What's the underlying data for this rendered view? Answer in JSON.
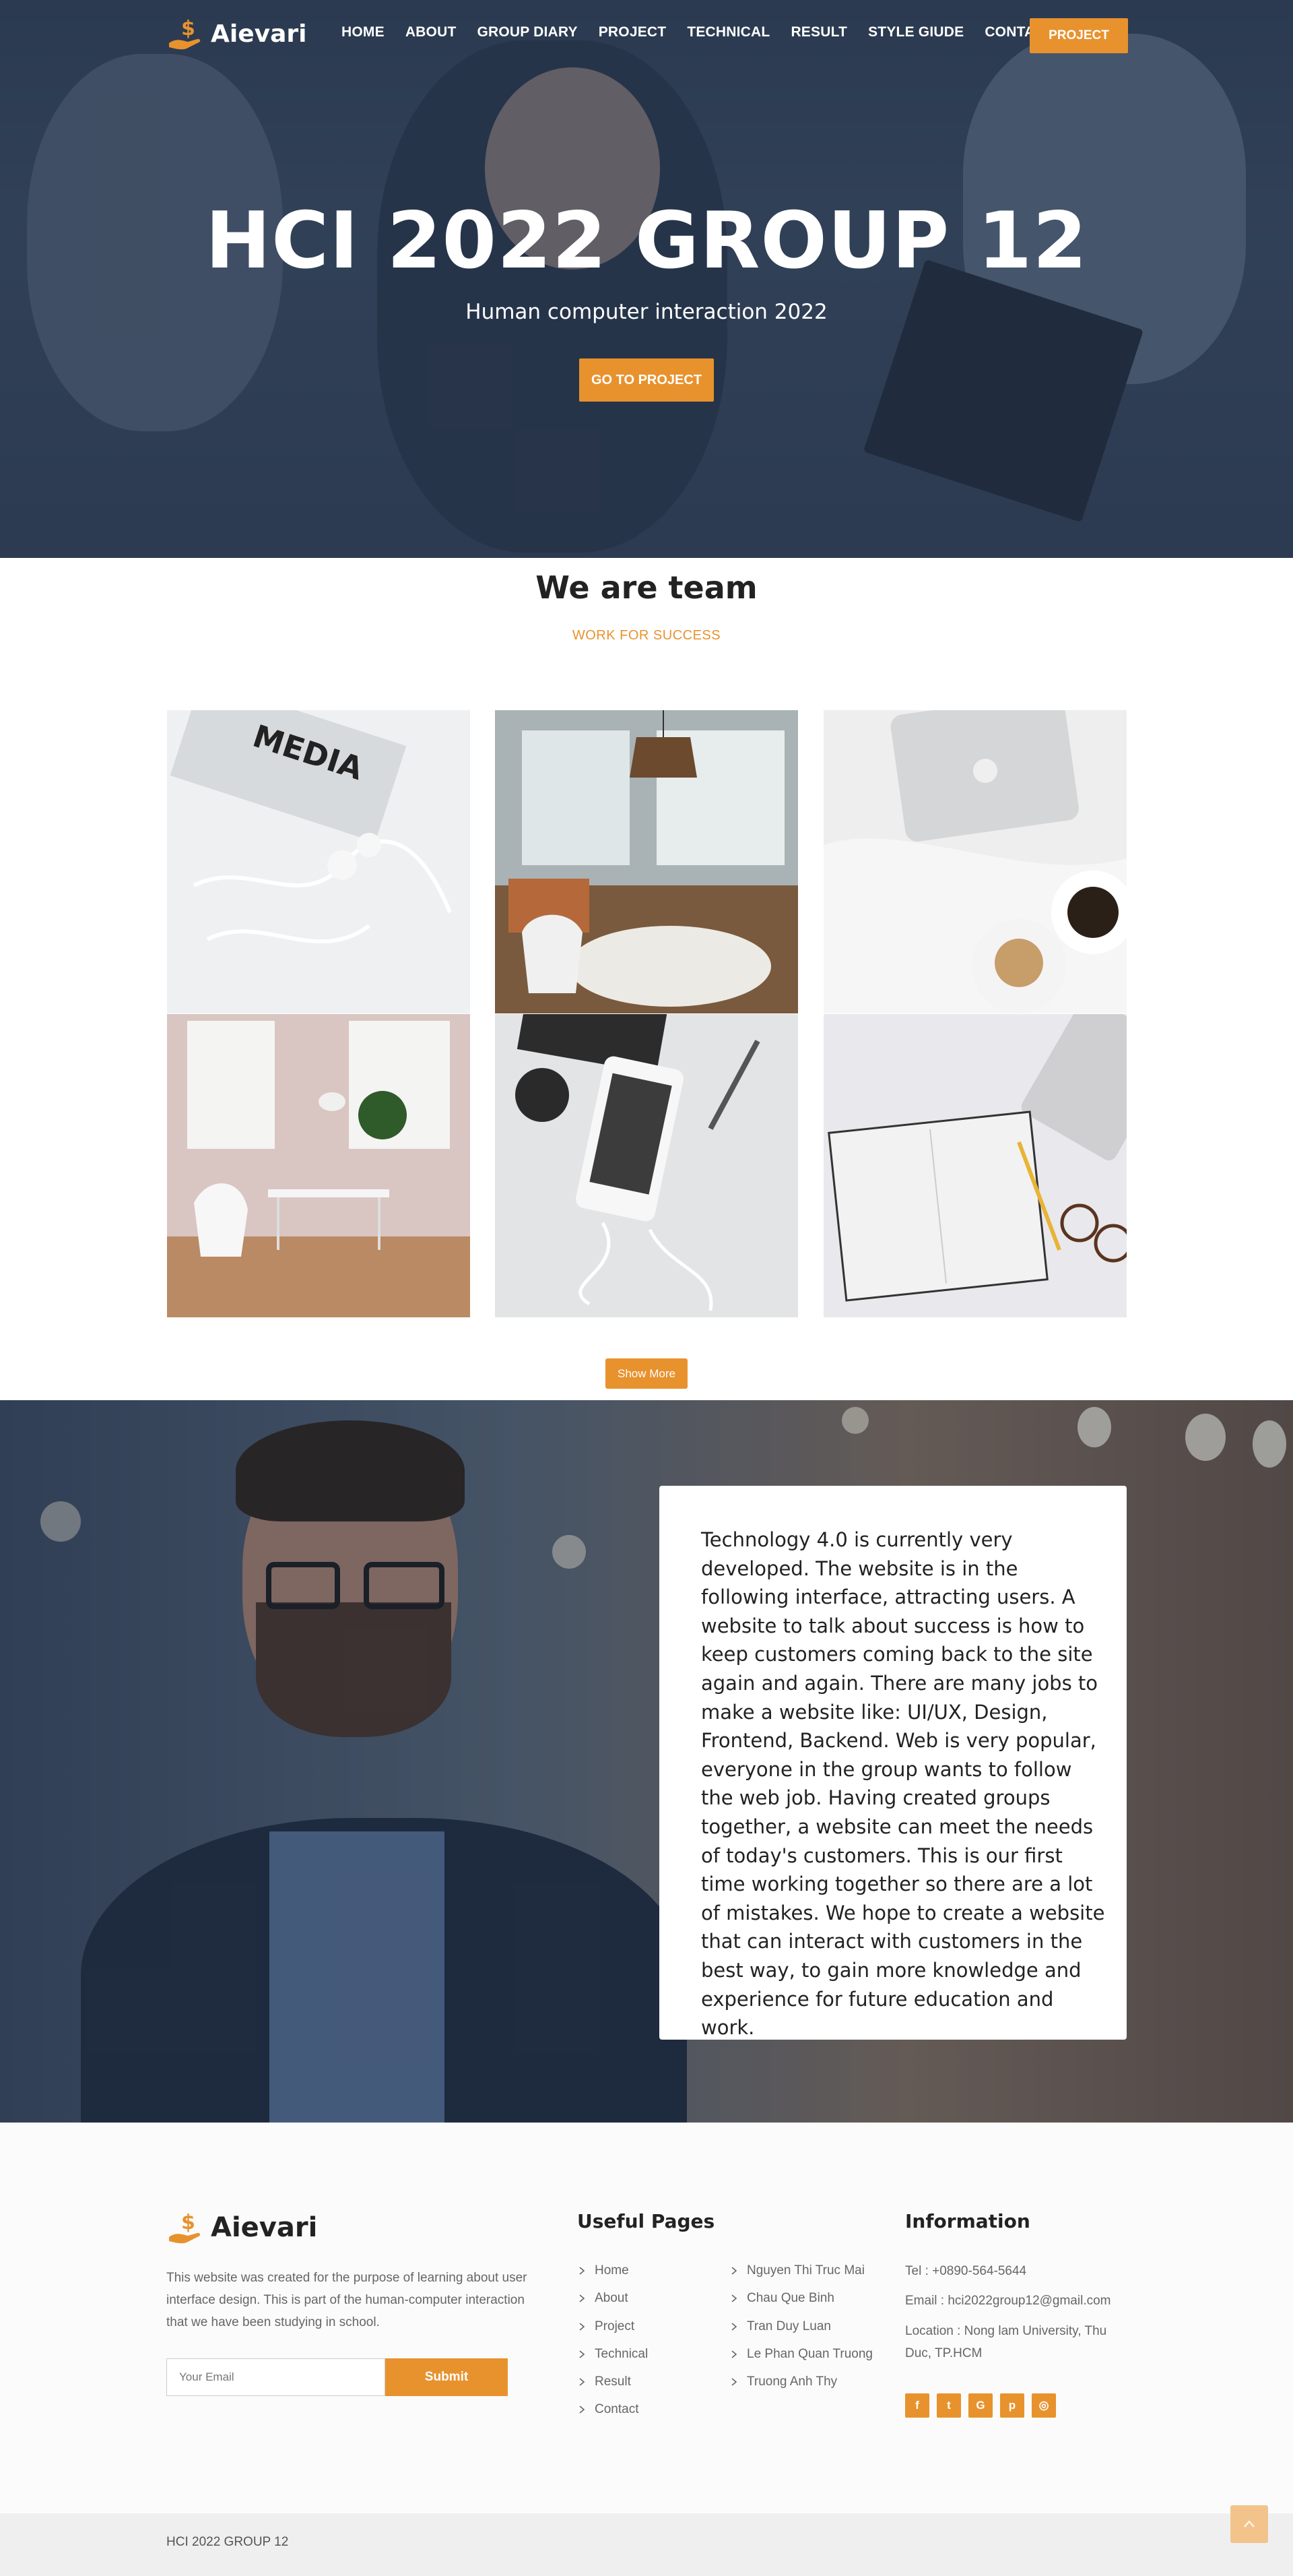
{
  "brand": {
    "name": "Aievari",
    "logo_icon": "dollar-hand-icon",
    "accent": "#e8922e"
  },
  "nav": {
    "items": [
      "HOME",
      "ABOUT",
      "GROUP DIARY",
      "PROJECT",
      "TECHNICAL",
      "RESULT",
      "STYLE GIUDE",
      "CONTACT"
    ],
    "cta": "PROJECT"
  },
  "hero": {
    "title": "HCI 2022 GROUP 12",
    "subtitle": "Human computer interaction 2022",
    "button": "GO TO PROJECT"
  },
  "team": {
    "title": "We are team",
    "subtitle": "WORK FOR SUCCESS",
    "show_more": "Show More"
  },
  "about": {
    "text": "Technology 4.0 is currently very developed. The website is in the following interface, attracting users. A website to talk about success is how to keep customers coming back to the site again and again. There are many jobs to make a website like: UI/UX, Design, Frontend, Backend. Web is very popular, everyone in the group wants to follow the web job. Having created groups together, a website can meet the needs of today's customers. This is our first time working together so there are a lot of mistakes. We hope to create a website that can interact with customers in the best way, to gain more knowledge and experience for future education and work."
  },
  "footer": {
    "brand": "Aievari",
    "description": "This website was created for the purpose of learning about user interface design. This is part of the human-computer interaction that we have been studying in school.",
    "email_placeholder": "Your Email",
    "submit": "Submit",
    "useful_pages_title": "Useful Pages",
    "pages": [
      "Home",
      "About",
      "Project",
      "Technical",
      "Result",
      "Contact"
    ],
    "members": [
      "Nguyen Thi Truc Mai",
      "Chau Que Binh",
      "Tran Duy Luan",
      "Le Phan Quan Truong",
      "Truong Anh Thy"
    ],
    "information_title": "Information",
    "tel": "Tel : +0890-564-5644",
    "email": "Email : hci2022group12@gmail.com",
    "location": "Location : Nong lam University, Thu Duc, TP.HCM",
    "social": [
      {
        "icon": "facebook-icon",
        "glyph": "f"
      },
      {
        "icon": "twitter-icon",
        "glyph": "t"
      },
      {
        "icon": "google-icon",
        "glyph": "G"
      },
      {
        "icon": "pinterest-icon",
        "glyph": "p"
      },
      {
        "icon": "instagram-icon",
        "glyph": "◎"
      }
    ],
    "copyright": "HCI 2022 GROUP 12"
  }
}
